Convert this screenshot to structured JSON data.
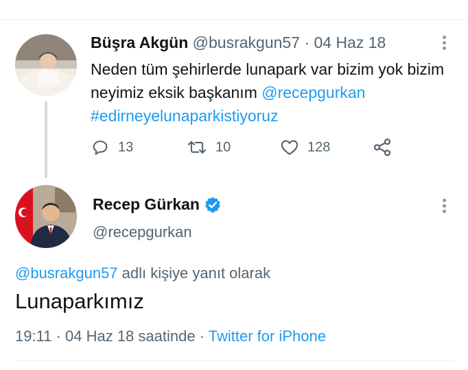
{
  "parent_tweet": {
    "author_name": "Büşra Akgün",
    "author_handle": "@busrakgun57",
    "separator": "·",
    "date": "04 Haz 18",
    "text_plain": "Neden tüm şehirlerde lunapark var bizim yok bizim neyimiz eksik başkanım ",
    "mention": "@recepgurkan",
    "hashtag": "#edirneyelunaparkistiyoruz",
    "reply_count": "13",
    "retweet_count": "10",
    "like_count": "128"
  },
  "main_tweet": {
    "author_name": "Recep Gürkan",
    "author_handle": "@recepgurkan",
    "reply_to_handle": "@busrakgun57",
    "reply_to_suffix": " adlı kişiye yanıt olarak",
    "text": "Lunaparkımız",
    "time": "19:11",
    "separator": "·",
    "date": "04 Haz 18 saatinde",
    "source": "Twitter for iPhone"
  },
  "icons": {
    "reply": "reply-icon",
    "retweet": "retweet-icon",
    "like": "heart-icon",
    "share": "share-icon",
    "more": "more-vertical-icon",
    "verified": "verified-badge-icon"
  },
  "colors": {
    "link": "#1d9bf0",
    "secondary_text": "#536471",
    "primary_text": "#0f1419",
    "verified": "#1d9bf0"
  }
}
